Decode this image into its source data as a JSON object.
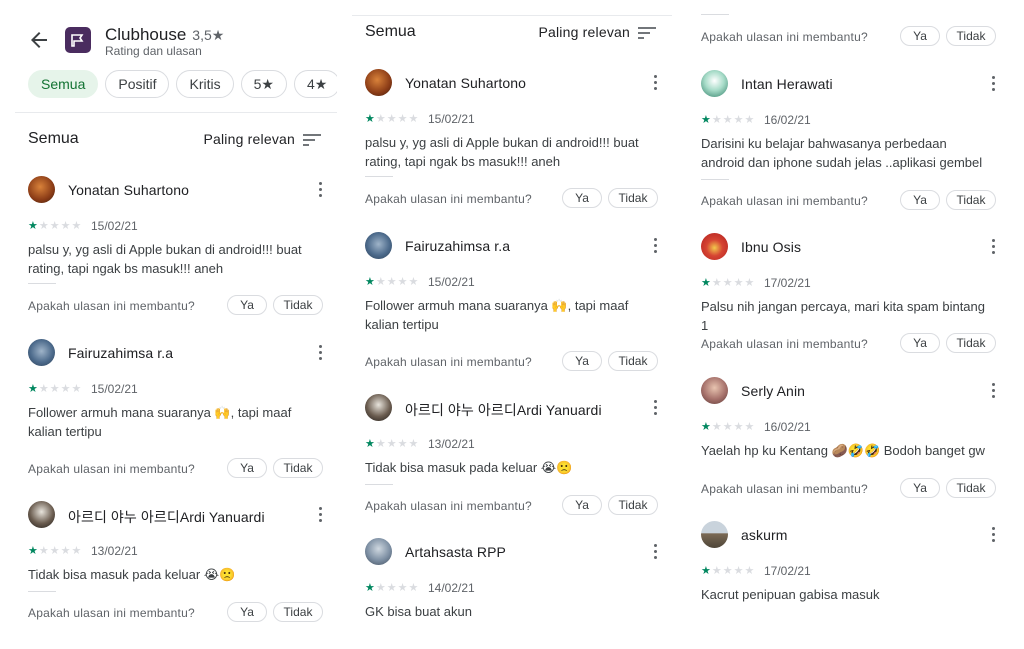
{
  "app": {
    "title": "Clubhouse",
    "rating": "3,5",
    "subtitle": "Rating dan ulasan"
  },
  "colors": {
    "accent": "#01875f",
    "chip_active_bg": "#e6f4ea",
    "chip_active_text": "#137333",
    "app_icon": "#4a2c5f"
  },
  "filters": [
    "Semua",
    "Positif",
    "Kritis",
    "5★",
    "4★"
  ],
  "sort": {
    "title": "Semua",
    "label": "Paling relevan"
  },
  "helpful": {
    "question": "Apakah ulasan ini membantu?",
    "yes": "Ya",
    "no": "Tidak"
  },
  "reviews": [
    {
      "name": "Yonatan Suhartono",
      "date": "15/02/21",
      "stars": 1,
      "text": "palsu y, yg asli di Apple bukan di android!!! buat rating, tapi ngak bs masuk!!! aneh"
    },
    {
      "name": "Fairuzahimsa r.a",
      "date": "15/02/21",
      "stars": 1,
      "text": "Follower armuh mana suaranya 🙌, tapi maaf kalian tertipu"
    },
    {
      "name": "아르디 야누 아르디Ardi Yanuardi",
      "date": "13/02/21",
      "stars": 1,
      "text": "Tidak bisa masuk pada keluar 😭🙁"
    },
    {
      "name": "Artahsasta RPP",
      "date": "14/02/21",
      "stars": 1,
      "text": "GK bisa buat akun"
    },
    {
      "name": "Intan Herawati",
      "date": "16/02/21",
      "stars": 1,
      "text": "Darisini ku belajar bahwasanya perbedaan android dan iphone sudah jelas ..aplikasi gembel"
    },
    {
      "name": "Ibnu Osis",
      "date": "17/02/21",
      "stars": 1,
      "text": "Palsu nih jangan percaya, mari kita spam bintang 1"
    },
    {
      "name": "Serly Anin",
      "date": "16/02/21",
      "stars": 1,
      "text": "Yaelah hp ku Kentang 🥔🤣🤣 Bodoh banget gw"
    },
    {
      "name": "askurm",
      "date": "17/02/21",
      "stars": 1,
      "text": "Kacrut penipuan gabisa masuk"
    }
  ]
}
